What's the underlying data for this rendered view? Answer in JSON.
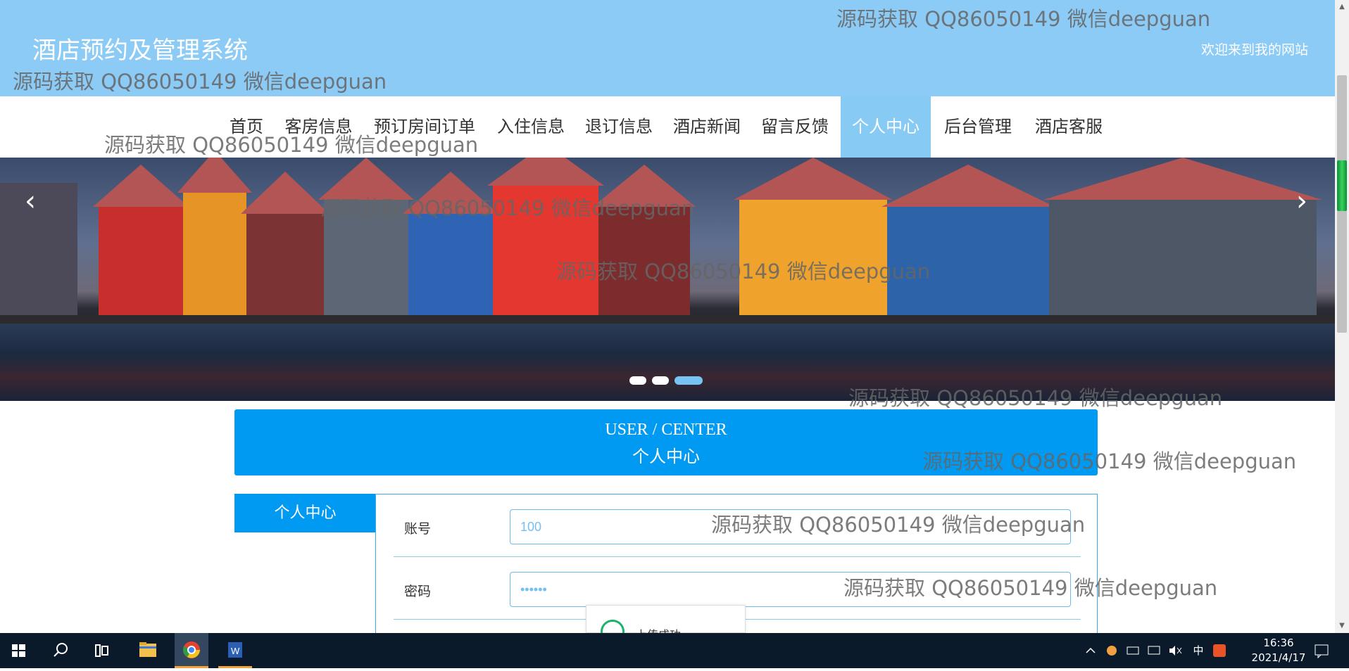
{
  "site": {
    "title": "酒店预约及管理系统",
    "welcome": "欢迎来到我的网站"
  },
  "watermarks": [
    "源码获取 QQ86050149 微信deepguan",
    "源码获取 QQ86050149 微信deepguan",
    "源码获取 QQ86050149 微信deepguan",
    "源码获取 QQ86050149 微信deepguan",
    "源码获取 QQ86050149 微信deepguan",
    "源码获取 QQ86050149 微信deepguan",
    "源码获取 QQ86050149 微信deepguan",
    "源码获取 QQ86050149 微信deepguan",
    "源码获取 QQ86050149 微信deepguan"
  ],
  "nav": {
    "items": [
      "首页",
      "客房信息",
      "预订房间订单",
      "入住信息",
      "退订信息",
      "酒店新闻",
      "留言反馈",
      "个人中心",
      "后台管理",
      "酒店客服"
    ],
    "active": "个人中心"
  },
  "banner": {
    "prev": "‹",
    "next": "›",
    "slides": 3,
    "active_slide": 3
  },
  "center": {
    "en": "USER / CENTER",
    "cn": "个人中心"
  },
  "side_menu": {
    "label": "个人中心"
  },
  "form": {
    "account_label": "账号",
    "account_value": "100",
    "password_label": "密码",
    "password_value": "••••••"
  },
  "toast": {
    "text": "上传成功"
  },
  "taskbar": {
    "time": "16:36",
    "date": "2021/4/17",
    "ime": "中"
  },
  "colors": {
    "header": "#8ccbf5",
    "accent": "#009af2"
  }
}
